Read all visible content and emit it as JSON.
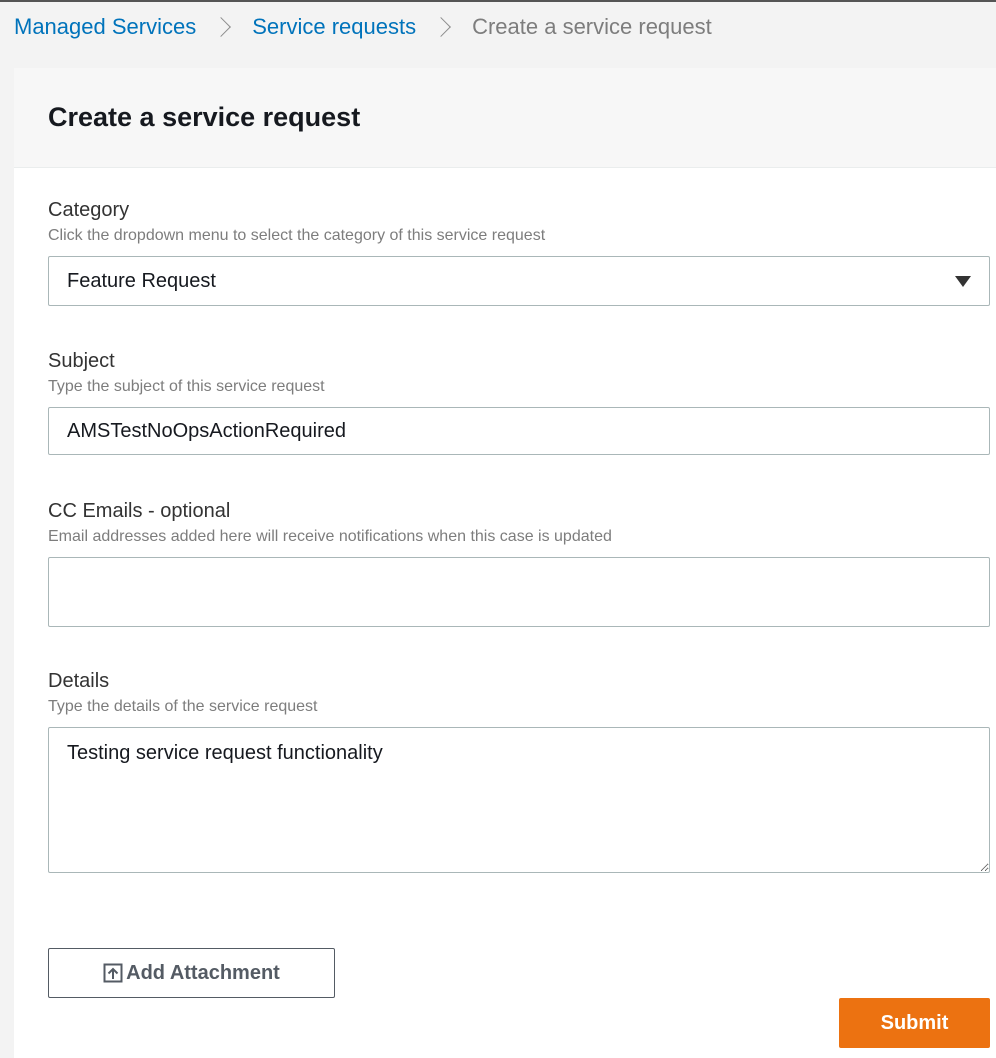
{
  "breadcrumb": {
    "items": [
      {
        "label": "Managed Services"
      },
      {
        "label": "Service requests"
      }
    ],
    "current": "Create a service request"
  },
  "panel": {
    "title": "Create a service request"
  },
  "form": {
    "category": {
      "label": "Category",
      "description": "Click the dropdown menu to select the category of this service request",
      "value": "Feature Request"
    },
    "subject": {
      "label": "Subject",
      "description": "Type the subject of this service request",
      "value": "AMSTestNoOpsActionRequired"
    },
    "cc_emails": {
      "label": "CC Emails - optional",
      "description": "Email addresses added here will receive notifications when this case is updated",
      "value": ""
    },
    "details": {
      "label": "Details",
      "description": "Type the details of the service request",
      "value": "Testing service request functionality"
    }
  },
  "actions": {
    "attach_label": "Add Attachment",
    "submit_label": "Submit"
  },
  "icons": {
    "chevron": "chevron-right-icon",
    "caret": "caret-down-icon",
    "upload": "upload-icon"
  },
  "colors": {
    "link": "#0073bb",
    "primary": "#ec7211"
  }
}
